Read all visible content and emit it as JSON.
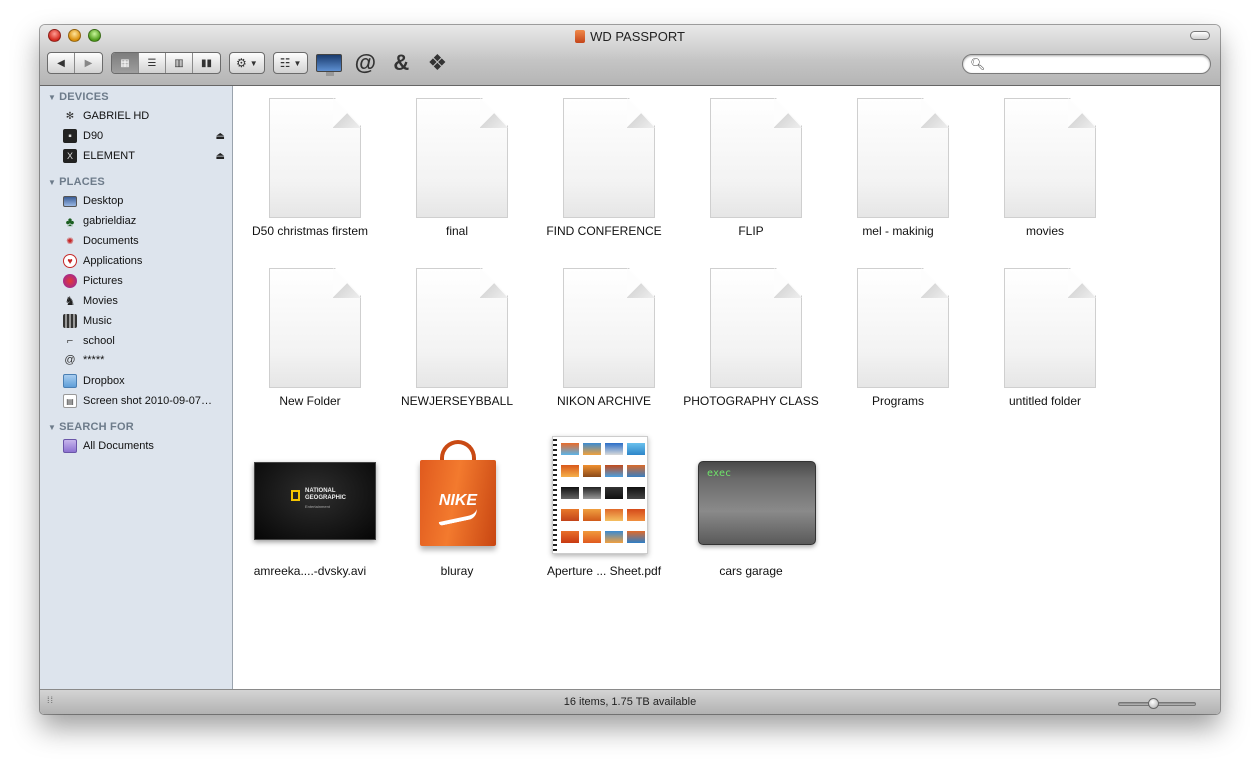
{
  "window": {
    "title": "WD PASSPORT"
  },
  "toolbar": {
    "back_icon": "back-arrow",
    "forward_icon": "forward-arrow",
    "view_modes": [
      "icon-view",
      "list-view",
      "column-view",
      "coverflow-view"
    ],
    "active_view": "icon-view",
    "action_icon": "gear-icon",
    "arrange_icon": "arrange-icon",
    "extra_icons": [
      "monitor-icon",
      "at-sign-icon",
      "ampersand-icon",
      "dropbox-icon"
    ],
    "search_placeholder": "",
    "search_value": ""
  },
  "sidebar": {
    "devices_heading": "DEVICES",
    "devices": [
      {
        "label": "GABRIEL HD",
        "icon": "network-disk-icon",
        "eject": false
      },
      {
        "label": "D90",
        "icon": "camera-drive-icon",
        "eject": true
      },
      {
        "label": "ELEMENT",
        "icon": "drive-icon",
        "eject": true
      }
    ],
    "places_heading": "PLACES",
    "places": [
      {
        "label": "Desktop",
        "icon": "desktop-icon"
      },
      {
        "label": "gabrieldiaz",
        "icon": "home-icon"
      },
      {
        "label": "Documents",
        "icon": "documents-icon"
      },
      {
        "label": "Applications",
        "icon": "applications-icon"
      },
      {
        "label": "Pictures",
        "icon": "pictures-icon"
      },
      {
        "label": "Movies",
        "icon": "movies-icon"
      },
      {
        "label": "Music",
        "icon": "music-icon"
      },
      {
        "label": "school",
        "icon": "school-icon"
      },
      {
        "label": "*****",
        "icon": "spiral-icon"
      },
      {
        "label": "Dropbox",
        "icon": "dropbox-folder-icon"
      },
      {
        "label": "Screen shot 2010-09-07…",
        "icon": "screenshot-file-icon"
      }
    ],
    "search_heading": "SEARCH FOR",
    "search_items": [
      {
        "label": "All Documents",
        "icon": "smart-folder-icon"
      }
    ]
  },
  "files": [
    {
      "label": "D50 christmas firstem",
      "kind": "document"
    },
    {
      "label": "final",
      "kind": "document"
    },
    {
      "label": "FIND CONFERENCE",
      "kind": "document"
    },
    {
      "label": "FLIP",
      "kind": "document"
    },
    {
      "label": "mel - makinig",
      "kind": "document"
    },
    {
      "label": "movies",
      "kind": "document"
    },
    {
      "label": "New Folder",
      "kind": "document"
    },
    {
      "label": "NEWJERSEYBBALL",
      "kind": "document"
    },
    {
      "label": "NIKON ARCHIVE",
      "kind": "document"
    },
    {
      "label": "PHOTOGRAPHY CLASS",
      "kind": "document"
    },
    {
      "label": "Programs",
      "kind": "document"
    },
    {
      "label": "untitled folder",
      "kind": "document"
    },
    {
      "label": "amreeka....-dvsky.avi",
      "kind": "video",
      "thumb_text": "NATIONAL GEOGRAPHIC",
      "thumb_subtext": "Entertainment"
    },
    {
      "label": "bluray",
      "kind": "bag",
      "thumb_text": "NIKE"
    },
    {
      "label": "Aperture ... Sheet.pdf",
      "kind": "pdf"
    },
    {
      "label": "cars garage",
      "kind": "exec",
      "thumb_text": "exec"
    }
  ],
  "status": {
    "text": "16 items, 1.75 TB available",
    "icon_size_level": 0.45
  },
  "colors": {
    "sidebar_bg": "#dde4ed",
    "section_heading": "#6d7b8a",
    "toolbar_top": "#e9e9e9",
    "toolbar_bottom": "#b5b5b5"
  }
}
